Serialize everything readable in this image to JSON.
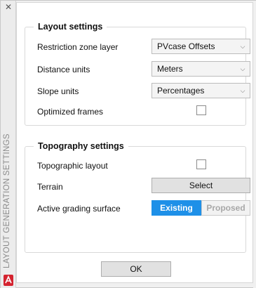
{
  "window": {
    "close_glyph": "✕",
    "side_title": "LAYOUT GENERATION SETTINGS",
    "logo_icon": "app-logo-icon"
  },
  "layout_settings": {
    "title": "Layout settings",
    "restriction_zone_layer": {
      "label": "Restriction zone layer",
      "value": "PVcase Offsets"
    },
    "distance_units": {
      "label": "Distance units",
      "value": "Meters"
    },
    "slope_units": {
      "label": "Slope units",
      "value": "Percentages"
    },
    "optimized_frames": {
      "label": "Optimized frames",
      "checked": false
    }
  },
  "topography_settings": {
    "title": "Topography settings",
    "topographic_layout": {
      "label": "Topographic layout",
      "checked": false
    },
    "terrain": {
      "label": "Terrain",
      "button_label": "Select"
    },
    "active_grading_surface": {
      "label": "Active grading surface",
      "options": [
        "Existing",
        "Proposed"
      ],
      "selected": "Existing"
    }
  },
  "footer": {
    "ok_label": "OK"
  },
  "colors": {
    "accent": "#1e90e8",
    "logo": "#d4232f"
  }
}
